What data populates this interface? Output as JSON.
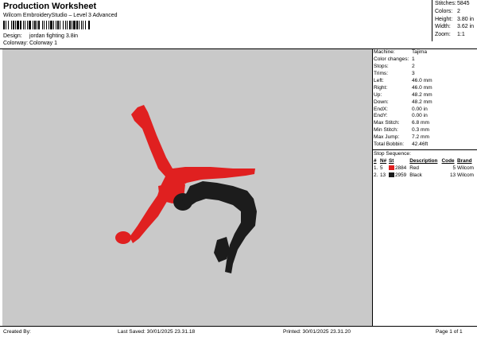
{
  "header": {
    "title": "Production Worksheet",
    "subtitle": "Wilcom EmbroideryStudio – Level 3 Advanced",
    "design_label": "Design:",
    "design_value": "jordan fighting 3.8in",
    "colorway_label": "Colorway:",
    "colorway_value": "Colorway 1"
  },
  "stats": [
    {
      "label": "Stitches:",
      "value": "5845"
    },
    {
      "label": "Colors:",
      "value": "2"
    },
    {
      "label": "Height:",
      "value": "3.80 in"
    },
    {
      "label": "Width:",
      "value": "3.62 in"
    },
    {
      "label": "Zoom:",
      "value": "1:1"
    }
  ],
  "machine": [
    {
      "label": "Machine:",
      "value": "Tajima"
    },
    {
      "label": "Color changes:",
      "value": "1"
    },
    {
      "label": "Stops:",
      "value": "2"
    },
    {
      "label": "Trims:",
      "value": "3"
    },
    {
      "label": "Left:",
      "value": "46.0 mm"
    },
    {
      "label": "Right:",
      "value": "46.0 mm"
    },
    {
      "label": "Up:",
      "value": "48.2 mm"
    },
    {
      "label": "Down:",
      "value": "48.2 mm"
    },
    {
      "label": "EndX:",
      "value": "0.00 in"
    },
    {
      "label": "EndY:",
      "value": "0.00 in"
    },
    {
      "label": "Max Stitch:",
      "value": "6.8 mm"
    },
    {
      "label": "Min Stitch:",
      "value": "0.3 mm"
    },
    {
      "label": "Max Jump:",
      "value": "7.2 mm"
    },
    {
      "label": "Total Bobbin:",
      "value": "42.46ft"
    }
  ],
  "stop_sequence": {
    "title": "Stop Sequence:",
    "columns": [
      "#",
      "N#",
      "St",
      "Description",
      "Code",
      "Brand"
    ],
    "rows": [
      {
        "idx": "1.",
        "needle": "5",
        "color": "#e02020",
        "stitches": "2884",
        "description": "Red",
        "code": "5",
        "brand": "Wilcom"
      },
      {
        "idx": "2.",
        "needle": "13",
        "color": "#1a1a1a",
        "stitches": "2959",
        "description": "Black",
        "code": "13",
        "brand": "Wilcom"
      }
    ]
  },
  "colors": {
    "canvas": "#c9c9c9",
    "red": "#e02020",
    "black": "#1c1c1c"
  },
  "footer": {
    "created_by": "Created By:",
    "last_saved": "Last Saved: 30/01/2025 23.31.18",
    "printed": "Printed: 30/01/2025 23.31.20",
    "page": "Page 1 of 1"
  }
}
